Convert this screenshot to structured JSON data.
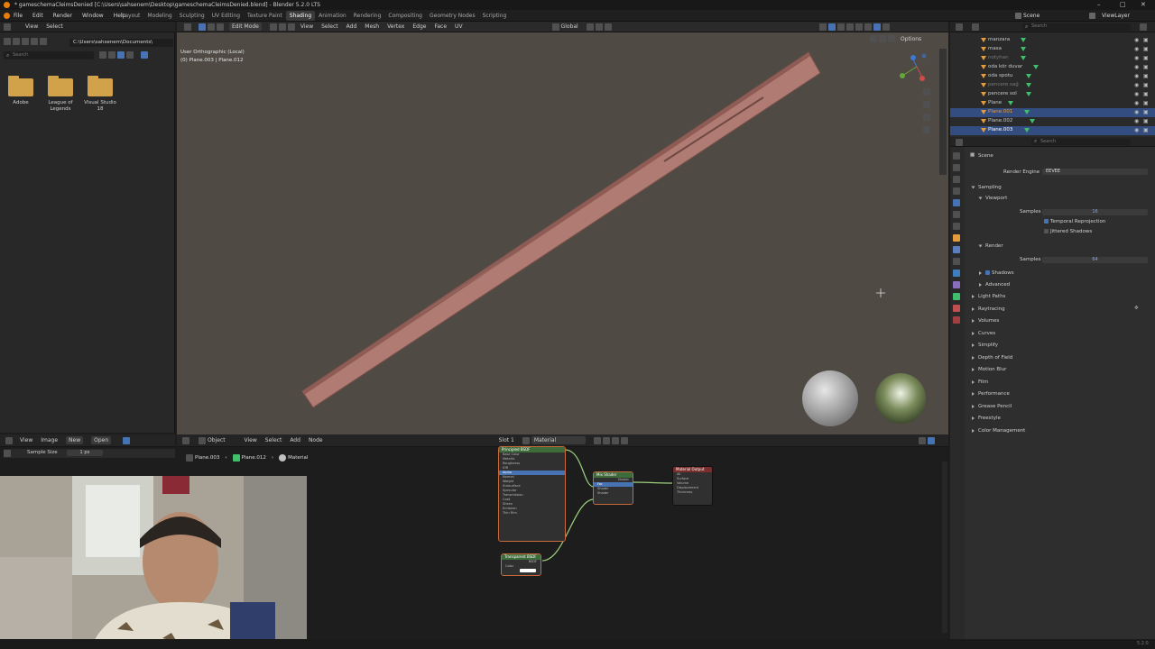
{
  "window": {
    "title": "* gameschemaCleimsDenied [C:\\Users\\sahsenem\\Desktop\\gameschemaCleimsDenied.blend] - Blender 5.2.0 LTS",
    "controls": [
      "–",
      "□",
      "✕"
    ]
  },
  "menubar": {
    "items": [
      "File",
      "Edit",
      "Render",
      "Window",
      "Help"
    ],
    "workspaces": [
      "Layout",
      "Modeling",
      "Sculpting",
      "UV Editing",
      "Texture Paint",
      "Shading",
      "Animation",
      "Rendering",
      "Compositing",
      "Geometry Nodes",
      "Scripting"
    ],
    "active_workspace": "Shading",
    "scene_label": "Scene",
    "viewlayer_label": "ViewLayer"
  },
  "filebrowser": {
    "header": [
      "View",
      "Select"
    ],
    "path": "C:\\Users\\sahsenem\\Documents\\",
    "search_placeholder": "Search",
    "folders": [
      {
        "label": "Adobe"
      },
      {
        "label": "League of Legends"
      },
      {
        "label": "Visual Studio 18"
      }
    ]
  },
  "viewport": {
    "header": {
      "mode": "Edit Mode",
      "menus": [
        "View",
        "Select",
        "Add",
        "Mesh",
        "Vertex",
        "Edge",
        "Face",
        "UV"
      ],
      "transform": "Global",
      "options": "Options"
    },
    "overlay_line1": "User Orthographic (Local)",
    "overlay_line2": "(0) Plane.003 | Plane.012"
  },
  "image_editor": {
    "header": [
      "View",
      "Image",
      "New",
      "Open"
    ],
    "sample_size_label": "Sample Size",
    "sample_size_value": "1 px"
  },
  "node_editor": {
    "header": {
      "object_mode": "Object",
      "menus": [
        "View",
        "Select",
        "Add",
        "Node"
      ],
      "slot": "Slot 1",
      "material": "Material"
    },
    "breadcrumb": [
      "Plane.003",
      "Plane.012",
      "Material"
    ],
    "nodes": {
      "principled": {
        "title": "Principled BSDF",
        "rows": [
          "Base Color",
          "Metallic",
          "Roughness",
          "IOR",
          "Alpha",
          "Normal",
          "Weight",
          "Subsurface",
          "Specular",
          "Transmission",
          "Coat",
          "Sheen",
          "Emission",
          "Thin Film"
        ]
      },
      "mix": {
        "title": "Mix Shader",
        "rows": [
          "Shader",
          "Fac",
          "Shader",
          "Shader"
        ]
      },
      "output": {
        "title": "Material Output",
        "rows": [
          "All",
          "Surface",
          "Volume",
          "Displacement",
          "Thickness"
        ]
      },
      "transparent": {
        "title": "Transparent BSDF",
        "rows": [
          "BSDF",
          "Color"
        ]
      }
    }
  },
  "outliner": {
    "search_placeholder": "Search",
    "items": [
      {
        "name": "manzara",
        "selected": false,
        "dim": false
      },
      {
        "name": "masa",
        "selected": false,
        "dim": false
      },
      {
        "name": "notyhan",
        "selected": false,
        "dim": true
      },
      {
        "name": "oda kör duvar",
        "selected": false,
        "dim": false
      },
      {
        "name": "oda spotu",
        "selected": false,
        "dim": false
      },
      {
        "name": "pencere sağ",
        "selected": false,
        "dim": true
      },
      {
        "name": "pencere sol",
        "selected": false,
        "dim": false
      },
      {
        "name": "Plane",
        "selected": false,
        "dim": false
      },
      {
        "name": "Plane.001",
        "selected": true,
        "dim": false
      },
      {
        "name": "Plane.002",
        "selected": false,
        "dim": false
      },
      {
        "name": "Plane.003",
        "selected": true,
        "dim": false
      }
    ]
  },
  "properties": {
    "search_placeholder": "Search",
    "context": "Scene",
    "render_engine_label": "Render Engine",
    "render_engine_value": "EEVEE",
    "sampling": {
      "title": "Sampling",
      "viewport_title": "Viewport",
      "viewport_samples_label": "Samples",
      "viewport_samples_value": "16",
      "temporal_reprojection": "Temporal Reprojection",
      "jittered_shadows": "Jittered Shadows",
      "render_title": "Render",
      "render_samples_label": "Samples",
      "render_samples_value": "64",
      "shadows": "Shadows",
      "advanced": "Advanced"
    },
    "panels": [
      "Light Paths",
      "Raytracing",
      "Volumes",
      "Curves",
      "Simplify",
      "Depth of Field",
      "Motion Blur",
      "Film",
      "Performance",
      "Grease Pencil",
      "Freestyle",
      "Color Management"
    ]
  },
  "statusbar": {
    "version": "5.2.0"
  },
  "colors": {
    "accent": "#4772b3",
    "selection": "#334d80",
    "object_triangle": "#e89b3c",
    "material_icon": "#3fbf6a",
    "viewport_bg": "#4f4b44",
    "plank": "#b07b72",
    "folder": "#d2a24a"
  }
}
